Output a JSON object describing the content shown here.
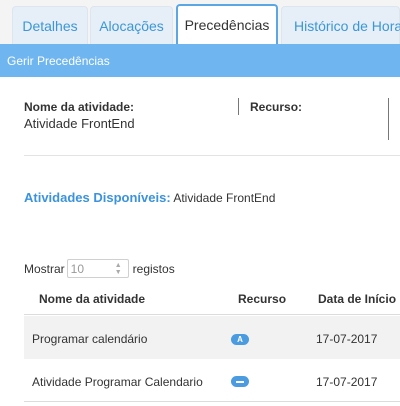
{
  "tabs": [
    {
      "label": "Detalhes"
    },
    {
      "label": "Alocações"
    },
    {
      "label": "Precedências"
    },
    {
      "label": "Histórico de Horas"
    }
  ],
  "section_title": "Gerir Precedências",
  "info": {
    "activity_name_label": "Nome da atividade:",
    "activity_name_value": "Atividade FrontEnd",
    "resource_label": "Recurso:"
  },
  "available": {
    "label": "Atividades Disponíveis:",
    "value": "Atividade FrontEnd"
  },
  "show": {
    "prefix": "Mostrar",
    "value": "10",
    "suffix": "registos"
  },
  "table": {
    "headers": [
      "Nome da atividade",
      "Recurso",
      "Data de Início"
    ],
    "rows": [
      {
        "name": "Programar calendário",
        "resource_badge": "A",
        "start": "17-07-2017"
      },
      {
        "name": "Atividade Programar Calendario",
        "resource_badge": "",
        "start": "17-07-2017"
      }
    ]
  }
}
